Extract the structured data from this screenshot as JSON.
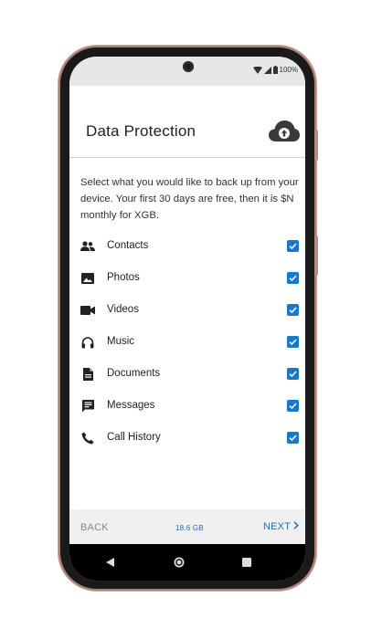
{
  "status_bar": {
    "battery_text": "100%",
    "icons": [
      "wifi-icon",
      "signal-icon",
      "battery-icon"
    ]
  },
  "header": {
    "title": "Data Protection",
    "icon": "cloud-upload-icon"
  },
  "description": "Select what you would like to back up from your device. Your first 30 days are free, then it is $N monthly for XGB.",
  "items": [
    {
      "label": "Contacts",
      "icon": "contacts-icon",
      "checked": true
    },
    {
      "label": "Photos",
      "icon": "photos-icon",
      "checked": true
    },
    {
      "label": "Videos",
      "icon": "videos-icon",
      "checked": true
    },
    {
      "label": "Music",
      "icon": "music-icon",
      "checked": true
    },
    {
      "label": "Documents",
      "icon": "documents-icon",
      "checked": true
    },
    {
      "label": "Messages",
      "icon": "messages-icon",
      "checked": true
    },
    {
      "label": "Call History",
      "icon": "call-history-icon",
      "checked": true
    }
  ],
  "footer": {
    "back_label": "BACK",
    "storage_label": "18.6 GB",
    "next_label": "NEXT"
  },
  "colors": {
    "accent": "#1878c9",
    "status_bar_bg": "#e7e7e7",
    "footer_bg": "#f0f0f0"
  }
}
